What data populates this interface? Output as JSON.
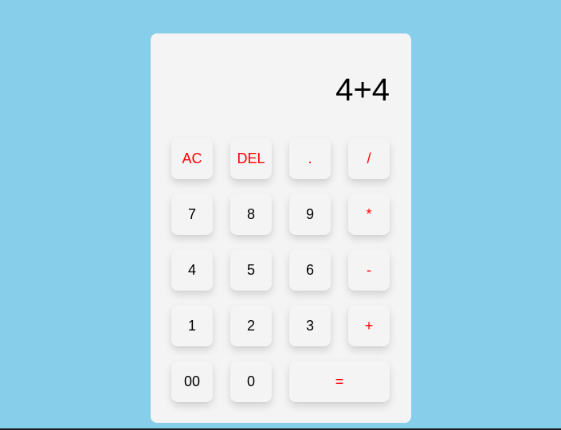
{
  "display": {
    "value": "4+4"
  },
  "keys": {
    "ac": "AC",
    "del": "DEL",
    "dot": ".",
    "divide": "/",
    "seven": "7",
    "eight": "8",
    "nine": "9",
    "multiply": "*",
    "four": "4",
    "five": "5",
    "six": "6",
    "minus": "-",
    "one": "1",
    "two": "2",
    "three": "3",
    "plus": "+",
    "double_zero": "00",
    "zero": "0",
    "equals": "="
  },
  "colors": {
    "background": "#87ceeb",
    "panel": "#f4f4f4",
    "operator_text": "#ff0000",
    "digit_text": "#000000"
  }
}
